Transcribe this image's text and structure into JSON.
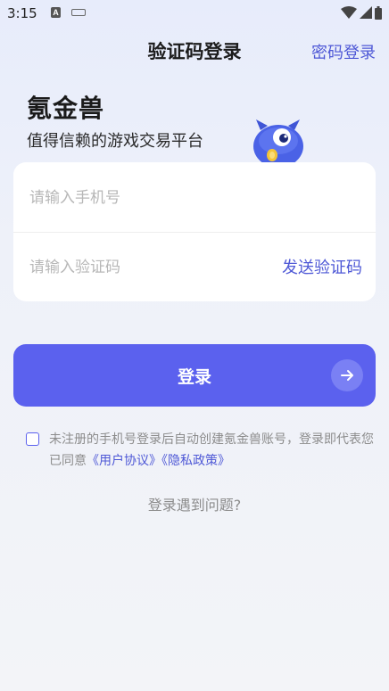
{
  "status_bar": {
    "time": "3:15",
    "icons": [
      "a-icon",
      "keyboard-icon",
      "wifi-icon",
      "signal-icon",
      "battery-icon"
    ]
  },
  "header": {
    "title": "验证码登录",
    "switch_label": "密码登录"
  },
  "brand": {
    "name": "氪金兽",
    "slogan": "值得信赖的游戏交易平台",
    "mascot": "blue-monster-mascot"
  },
  "form": {
    "phone_placeholder": "请输入手机号",
    "code_placeholder": "请输入验证码",
    "send_code_label": "发送验证码"
  },
  "login": {
    "label": "登录",
    "icon": "arrow-right-icon"
  },
  "agreement": {
    "checked": false,
    "text": "未注册的手机号登录后自动创建氪金兽账号，登录即代表您已同意",
    "user_agreement": "《用户协议》",
    "privacy_policy": "《隐私政策》"
  },
  "help": {
    "label": "登录遇到问题?"
  },
  "colors": {
    "accent": "#5b61ee",
    "link": "#4e58d6",
    "background": "#eef1f9"
  }
}
